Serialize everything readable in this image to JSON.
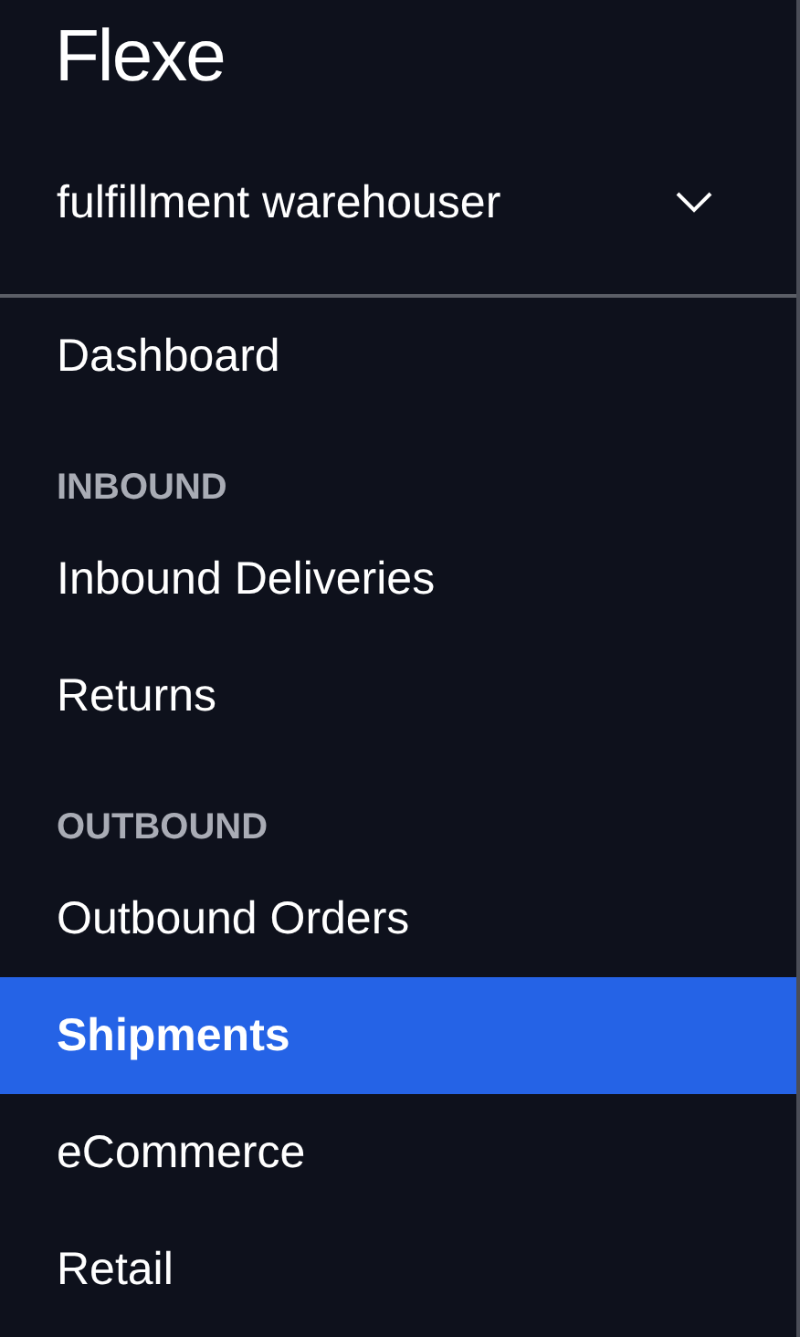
{
  "logo": "Flexe",
  "account": {
    "name": "fulfillment warehouser",
    "expanded": false
  },
  "nav": [
    {
      "kind": "link",
      "label": "Dashboard",
      "selected": false
    },
    {
      "kind": "header",
      "label": "INBOUND"
    },
    {
      "kind": "link",
      "label": "Inbound Deliveries",
      "selected": false
    },
    {
      "kind": "link",
      "label": "Returns",
      "selected": false
    },
    {
      "kind": "header",
      "label": "OUTBOUND"
    },
    {
      "kind": "link",
      "label": "Outbound Orders",
      "selected": false
    },
    {
      "kind": "link",
      "label": "Shipments",
      "selected": true
    },
    {
      "kind": "link",
      "label": "eCommerce",
      "selected": false
    },
    {
      "kind": "link",
      "label": "Retail",
      "selected": false
    }
  ]
}
